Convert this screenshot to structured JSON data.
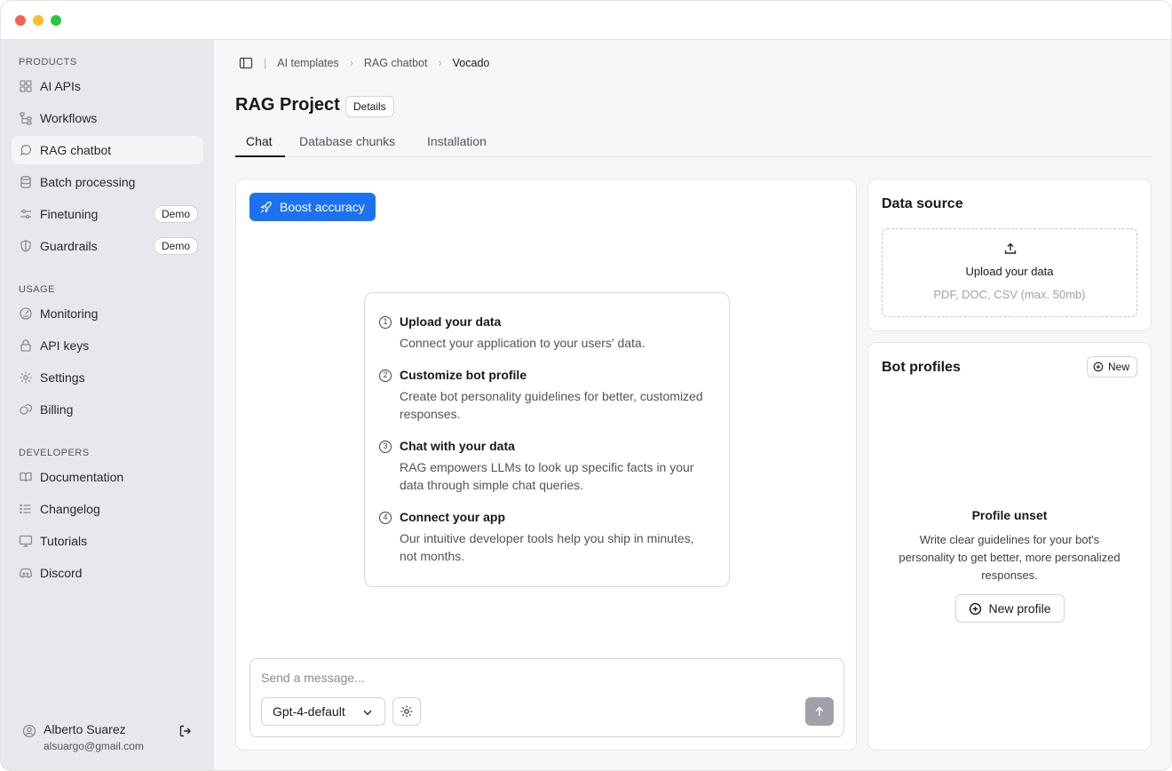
{
  "sidebar": {
    "sections": [
      {
        "label": "PRODUCTS"
      },
      {
        "label": "USAGE"
      },
      {
        "label": "DEVELOPERS"
      }
    ],
    "items": [
      {
        "label": "AI APIs",
        "icon": "grid-icon"
      },
      {
        "label": "Workflows",
        "icon": "workflow-icon"
      },
      {
        "label": "RAG chatbot",
        "icon": "chat-icon",
        "active": true
      },
      {
        "label": "Batch processing",
        "icon": "database-icon"
      },
      {
        "label": "Finetuning",
        "icon": "sliders-icon",
        "badge": "Demo"
      },
      {
        "label": "Guardrails",
        "icon": "shield-icon",
        "badge": "Demo"
      },
      {
        "label": "Monitoring",
        "icon": "gauge-icon"
      },
      {
        "label": "API keys",
        "icon": "lock-icon"
      },
      {
        "label": "Settings",
        "icon": "gear-icon"
      },
      {
        "label": "Billing",
        "icon": "coins-icon"
      },
      {
        "label": "Documentation",
        "icon": "book-icon"
      },
      {
        "label": "Changelog",
        "icon": "list-icon"
      },
      {
        "label": "Tutorials",
        "icon": "monitor-icon"
      },
      {
        "label": "Discord",
        "icon": "discord-icon"
      }
    ],
    "user": {
      "name": "Alberto Suarez",
      "email": "alsuargo@gmail.com"
    }
  },
  "breadcrumb": [
    "AI templates",
    "RAG chatbot",
    "Vocado"
  ],
  "page": {
    "title": "RAG Project",
    "details_label": "Details"
  },
  "tabs": [
    {
      "label": "Chat",
      "active": true
    },
    {
      "label": "Database chunks"
    },
    {
      "label": "Installation"
    }
  ],
  "chat": {
    "boost_label": "Boost accuracy",
    "steps": [
      {
        "num": "1",
        "title": "Upload your data",
        "desc": "Connect your application to your users' data."
      },
      {
        "num": "2",
        "title": "Customize bot profile",
        "desc": "Create bot personality guidelines for better, customized responses."
      },
      {
        "num": "3",
        "title": "Chat with your data",
        "desc": "RAG empowers LLMs to look up specific facts in your data through simple chat queries."
      },
      {
        "num": "4",
        "title": "Connect your app",
        "desc": "Our intuitive developer tools help you ship in minutes, not months."
      }
    ],
    "input_placeholder": "Send a message...",
    "model": "Gpt-4-default"
  },
  "data_source": {
    "title": "Data source",
    "upload_title": "Upload your data",
    "upload_hint": "PDF, DOC, CSV (max. 50mb)"
  },
  "bot_profiles": {
    "title": "Bot profiles",
    "new_label": "New",
    "empty_title": "Profile unset",
    "empty_desc": "Write clear guidelines for your bot's personality to get better, more personalized responses.",
    "new_profile_label": "New profile"
  },
  "colors": {
    "accent": "#1d72f2",
    "sidebar_bg": "#e8e8ec",
    "send_disabled": "#a1a1aa"
  }
}
